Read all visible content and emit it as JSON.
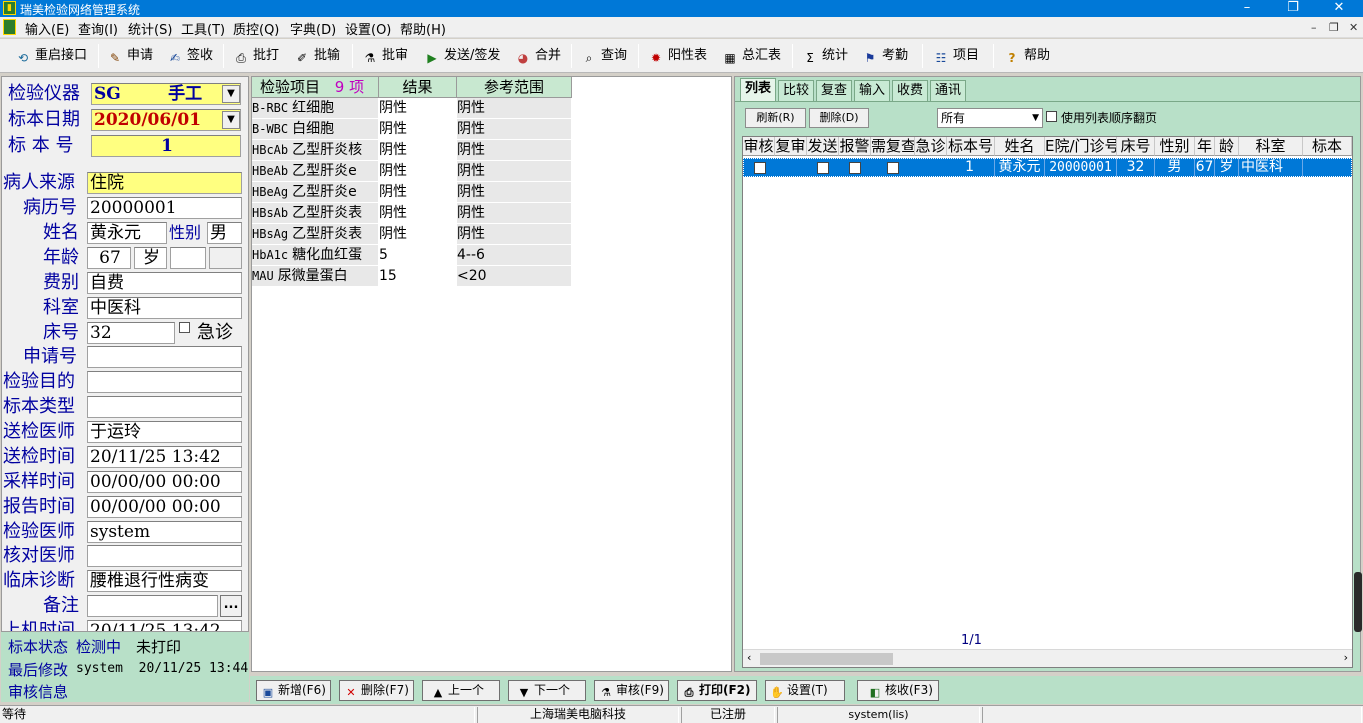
{
  "window": {
    "title": "瑞美检验网络管理系统",
    "controls": [
      "–",
      "❐",
      "✕"
    ]
  },
  "menu": [
    "输入(E)",
    "查询(I)",
    "统计(S)",
    "工具(T)",
    "质控(Q)",
    "字典(D)",
    "设置(O)",
    "帮助(H)"
  ],
  "mdi_controls": [
    "–",
    "❐",
    "✕"
  ],
  "toolbar": [
    {
      "label": "重启接口",
      "icon": "restart-interface-icon",
      "glyph": "⟲"
    },
    {
      "label": "申请",
      "icon": "apply-icon",
      "glyph": "✎"
    },
    {
      "label": "签收",
      "icon": "sign-in-icon",
      "glyph": "✍"
    },
    {
      "label": "批打",
      "icon": "batch-print-icon",
      "glyph": "⎙"
    },
    {
      "label": "批输",
      "icon": "batch-input-icon",
      "glyph": "✐"
    },
    {
      "label": "批审",
      "icon": "batch-review-icon",
      "glyph": "⚗"
    },
    {
      "label": "发送/签发",
      "icon": "send-icon",
      "glyph": "▶"
    },
    {
      "label": "合并",
      "icon": "merge-icon",
      "glyph": "◕"
    },
    {
      "label": "查询",
      "icon": "query-icon",
      "glyph": "⌕"
    },
    {
      "label": "阳性表",
      "icon": "positive-table-icon",
      "glyph": "✹"
    },
    {
      "label": "总汇表",
      "icon": "summary-table-icon",
      "glyph": "▦"
    },
    {
      "label": "统计",
      "icon": "sigma-icon",
      "glyph": "Σ"
    },
    {
      "label": "考勤",
      "icon": "attendance-icon",
      "glyph": "⚑"
    },
    {
      "label": "项目",
      "icon": "items-icon",
      "glyph": "☷"
    },
    {
      "label": "帮助",
      "icon": "help-icon",
      "glyph": "?"
    }
  ],
  "form": {
    "instrument_label": "检验仪器",
    "instrument_value": "SG        手工",
    "date_label": "标本日期",
    "date_value": "2020/06/01",
    "sample_no_label": "标 本 号",
    "sample_no_value": "1",
    "source_label": "病人来源",
    "source_value": "住院",
    "record_label": "病历号",
    "record_value": "20000001",
    "name_label": "姓名",
    "name_value": "黄永元",
    "sex_label": "性别",
    "sex_value": "男",
    "age_label": "年龄",
    "age_value": "67",
    "age_unit": "岁",
    "fee_label": "费别",
    "fee_value": "自费",
    "dept_label": "科室",
    "dept_value": "中医科",
    "bed_label": "床号",
    "bed_value": "32",
    "urgent_label": "急诊",
    "request_label": "申请号",
    "purpose_label": "检验目的",
    "type_label": "标本类型",
    "sender_label": "送检医师",
    "sender_value": "于运玲",
    "send_time_label": "送检时间",
    "send_time_value": "20/11/25 13:42",
    "sample_time_label": "采样时间",
    "sample_time_value": "00/00/00 00:00",
    "report_time_label": "报告时间",
    "report_time_value": "00/00/00 00:00",
    "doctor_label": "检验医师",
    "doctor_value": "system",
    "checker_label": "核对医师",
    "diagnosis_label": "临床诊断",
    "diagnosis_value": "腰椎退行性病变",
    "remark_label": "备注",
    "remark_button": "...",
    "machine_time_label": "上机时间",
    "machine_time_value": "20/11/25 13:42"
  },
  "left_status": {
    "state_label": "标本状态",
    "state_value": "检测中",
    "print_state": "未打印",
    "last_mod_label": "最后修改",
    "last_mod_value": "system  20/11/25 13:44",
    "review_label": "审核信息"
  },
  "results": {
    "header_item": "检验项目",
    "header_count": "9 项",
    "header_result": "结果",
    "header_range": "参考范围",
    "rows": [
      {
        "code": "B-RBC",
        "name": "红细胞",
        "result": "阴性",
        "range": "阴性"
      },
      {
        "code": "B-WBC",
        "name": "白细胞",
        "result": "阴性",
        "range": "阴性"
      },
      {
        "code": "HBcAb",
        "name": "乙型肝炎核",
        "result": "阴性",
        "range": "阴性"
      },
      {
        "code": "HBeAb",
        "name": "乙型肝炎e",
        "result": "阴性",
        "range": "阴性"
      },
      {
        "code": "HBeAg",
        "name": "乙型肝炎e",
        "result": "阴性",
        "range": "阴性"
      },
      {
        "code": "HBsAb",
        "name": "乙型肝炎表",
        "result": "阴性",
        "range": "阴性"
      },
      {
        "code": "HBsAg",
        "name": "乙型肝炎表",
        "result": "阴性",
        "range": "阴性"
      },
      {
        "code": "HbA1c",
        "name": "糖化血红蛋",
        "result": "5",
        "range": "4--6"
      },
      {
        "code": "MAU",
        "name": "尿微量蛋白",
        "result": "15",
        "range": "<20"
      }
    ]
  },
  "right_tabs": [
    "列表",
    "比较",
    "复查",
    "输入",
    "收费",
    "通讯"
  ],
  "right_buttons": {
    "refresh": "刷新(R)",
    "delete": "删除(D)",
    "filter_value": "所有",
    "paging_label": "使用列表顺序翻页"
  },
  "sample_list": {
    "headers": [
      "审核",
      "复审",
      "发送",
      "报警",
      "需复查",
      "急诊",
      "标本号",
      "姓名",
      "E院/门诊号",
      "床号",
      "性别",
      "年",
      "龄",
      "科室",
      "标本"
    ],
    "row": {
      "sample_no": "1",
      "name": "黄永元",
      "patient_no": "20000001",
      "bed": "32",
      "sex": "男",
      "age": "67",
      "age_unit": "岁",
      "dept": "中医科"
    },
    "pager": "1/1"
  },
  "bottom_buttons": [
    {
      "label": "新增(F6)",
      "icon": "new-icon",
      "glyph": "▣"
    },
    {
      "label": "删除(F7)",
      "icon": "delete-icon",
      "glyph": "✕"
    },
    {
      "label": "上一个",
      "icon": "up-arrow-icon",
      "glyph": "▲"
    },
    {
      "label": "下一个",
      "icon": "down-arrow-icon",
      "glyph": "▼"
    },
    {
      "label": "审核(F9)",
      "icon": "review-icon",
      "glyph": "⚗"
    },
    {
      "label": "打印(F2)",
      "icon": "print-icon",
      "glyph": "⎙"
    },
    {
      "label": "设置(T)",
      "icon": "settings-icon",
      "glyph": "✋"
    },
    {
      "label": "核收(F3)",
      "icon": "receive-icon",
      "glyph": "◧"
    }
  ],
  "statusbar": {
    "state": "等待",
    "company": "上海瑞美电脑科技",
    "registered": "已注册",
    "user": "system(lis)"
  },
  "colors": {
    "titlebar": "#0078d7",
    "panel_green": "#b8e0c8",
    "label_blue": "#0000a0",
    "selection": "#0078d7",
    "required_yellow": "#ffff80"
  }
}
